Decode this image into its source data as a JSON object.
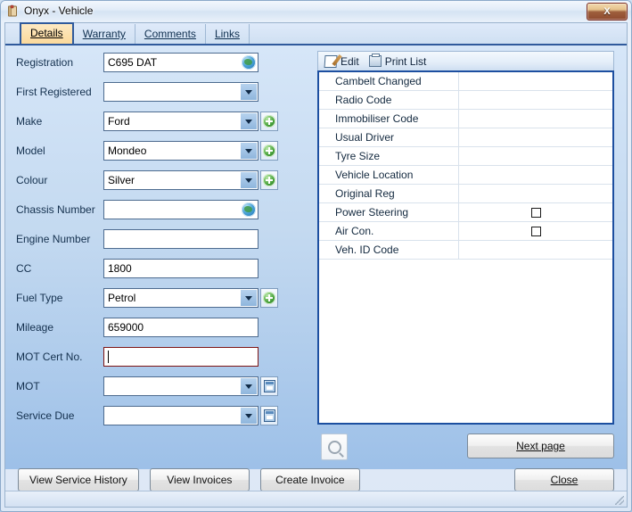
{
  "window": {
    "title": "Onyx - Vehicle",
    "app_icon": "notebook-icon",
    "close_label": "X"
  },
  "tabs": [
    {
      "label": "Details",
      "active": true
    },
    {
      "label": "Warranty",
      "active": false
    },
    {
      "label": "Comments",
      "active": false
    },
    {
      "label": "Links",
      "active": false
    }
  ],
  "form": {
    "fields": [
      {
        "label": "Registration",
        "type": "text",
        "value": "C695 DAT",
        "trailing": "globe"
      },
      {
        "label": "First Registered",
        "type": "combo",
        "value": "",
        "trailing": "none"
      },
      {
        "label": "Make",
        "type": "combo",
        "value": "Ford",
        "trailing": "plus"
      },
      {
        "label": "Model",
        "type": "combo",
        "value": "Mondeo",
        "trailing": "plus"
      },
      {
        "label": "Colour",
        "type": "combo",
        "value": "Silver",
        "trailing": "plus"
      },
      {
        "label": "Chassis Number",
        "type": "text",
        "value": "",
        "trailing": "globe"
      },
      {
        "label": "Engine Number",
        "type": "text",
        "value": "",
        "trailing": "none"
      },
      {
        "label": "CC",
        "type": "text",
        "value": "1800",
        "trailing": "none"
      },
      {
        "label": "Fuel Type",
        "type": "combo",
        "value": "Petrol",
        "trailing": "plus"
      },
      {
        "label": "Mileage",
        "type": "text",
        "value": "659000",
        "trailing": "none"
      },
      {
        "label": "MOT Cert No.",
        "type": "text-red",
        "value": "",
        "trailing": "none"
      },
      {
        "label": "MOT",
        "type": "combo",
        "value": "",
        "trailing": "calendar"
      },
      {
        "label": "Service Due",
        "type": "combo",
        "value": "",
        "trailing": "calendar"
      }
    ]
  },
  "list_panel": {
    "toolbar": {
      "edit_label": "Edit",
      "print_label": "Print List"
    },
    "rows": [
      {
        "label": "Cambelt Changed",
        "value": "",
        "checkbox": false
      },
      {
        "label": "Radio Code",
        "value": "",
        "checkbox": false
      },
      {
        "label": "Immobiliser Code",
        "value": "",
        "checkbox": false
      },
      {
        "label": "Usual Driver",
        "value": "",
        "checkbox": false
      },
      {
        "label": "Tyre Size",
        "value": "",
        "checkbox": false
      },
      {
        "label": "Vehicle Location",
        "value": "",
        "checkbox": false
      },
      {
        "label": "Original Reg",
        "value": "",
        "checkbox": false
      },
      {
        "label": "Power Steering",
        "value": "",
        "checkbox": true
      },
      {
        "label": "Air Con.",
        "value": "",
        "checkbox": true
      },
      {
        "label": "Veh. ID Code",
        "value": "",
        "checkbox": false
      }
    ],
    "next_page_label": "Next page",
    "search_icon": "magnifier-icon"
  },
  "footer": {
    "buttons": [
      {
        "label": "View Service History"
      },
      {
        "label": "View Invoices"
      },
      {
        "label": "Create Invoice"
      }
    ],
    "close_label": "Close"
  },
  "colors": {
    "accent": "#2f5a9c",
    "active_tab": "#fbd99b",
    "list_border": "#1d4fa0",
    "required_field_border": "#7d1414"
  }
}
